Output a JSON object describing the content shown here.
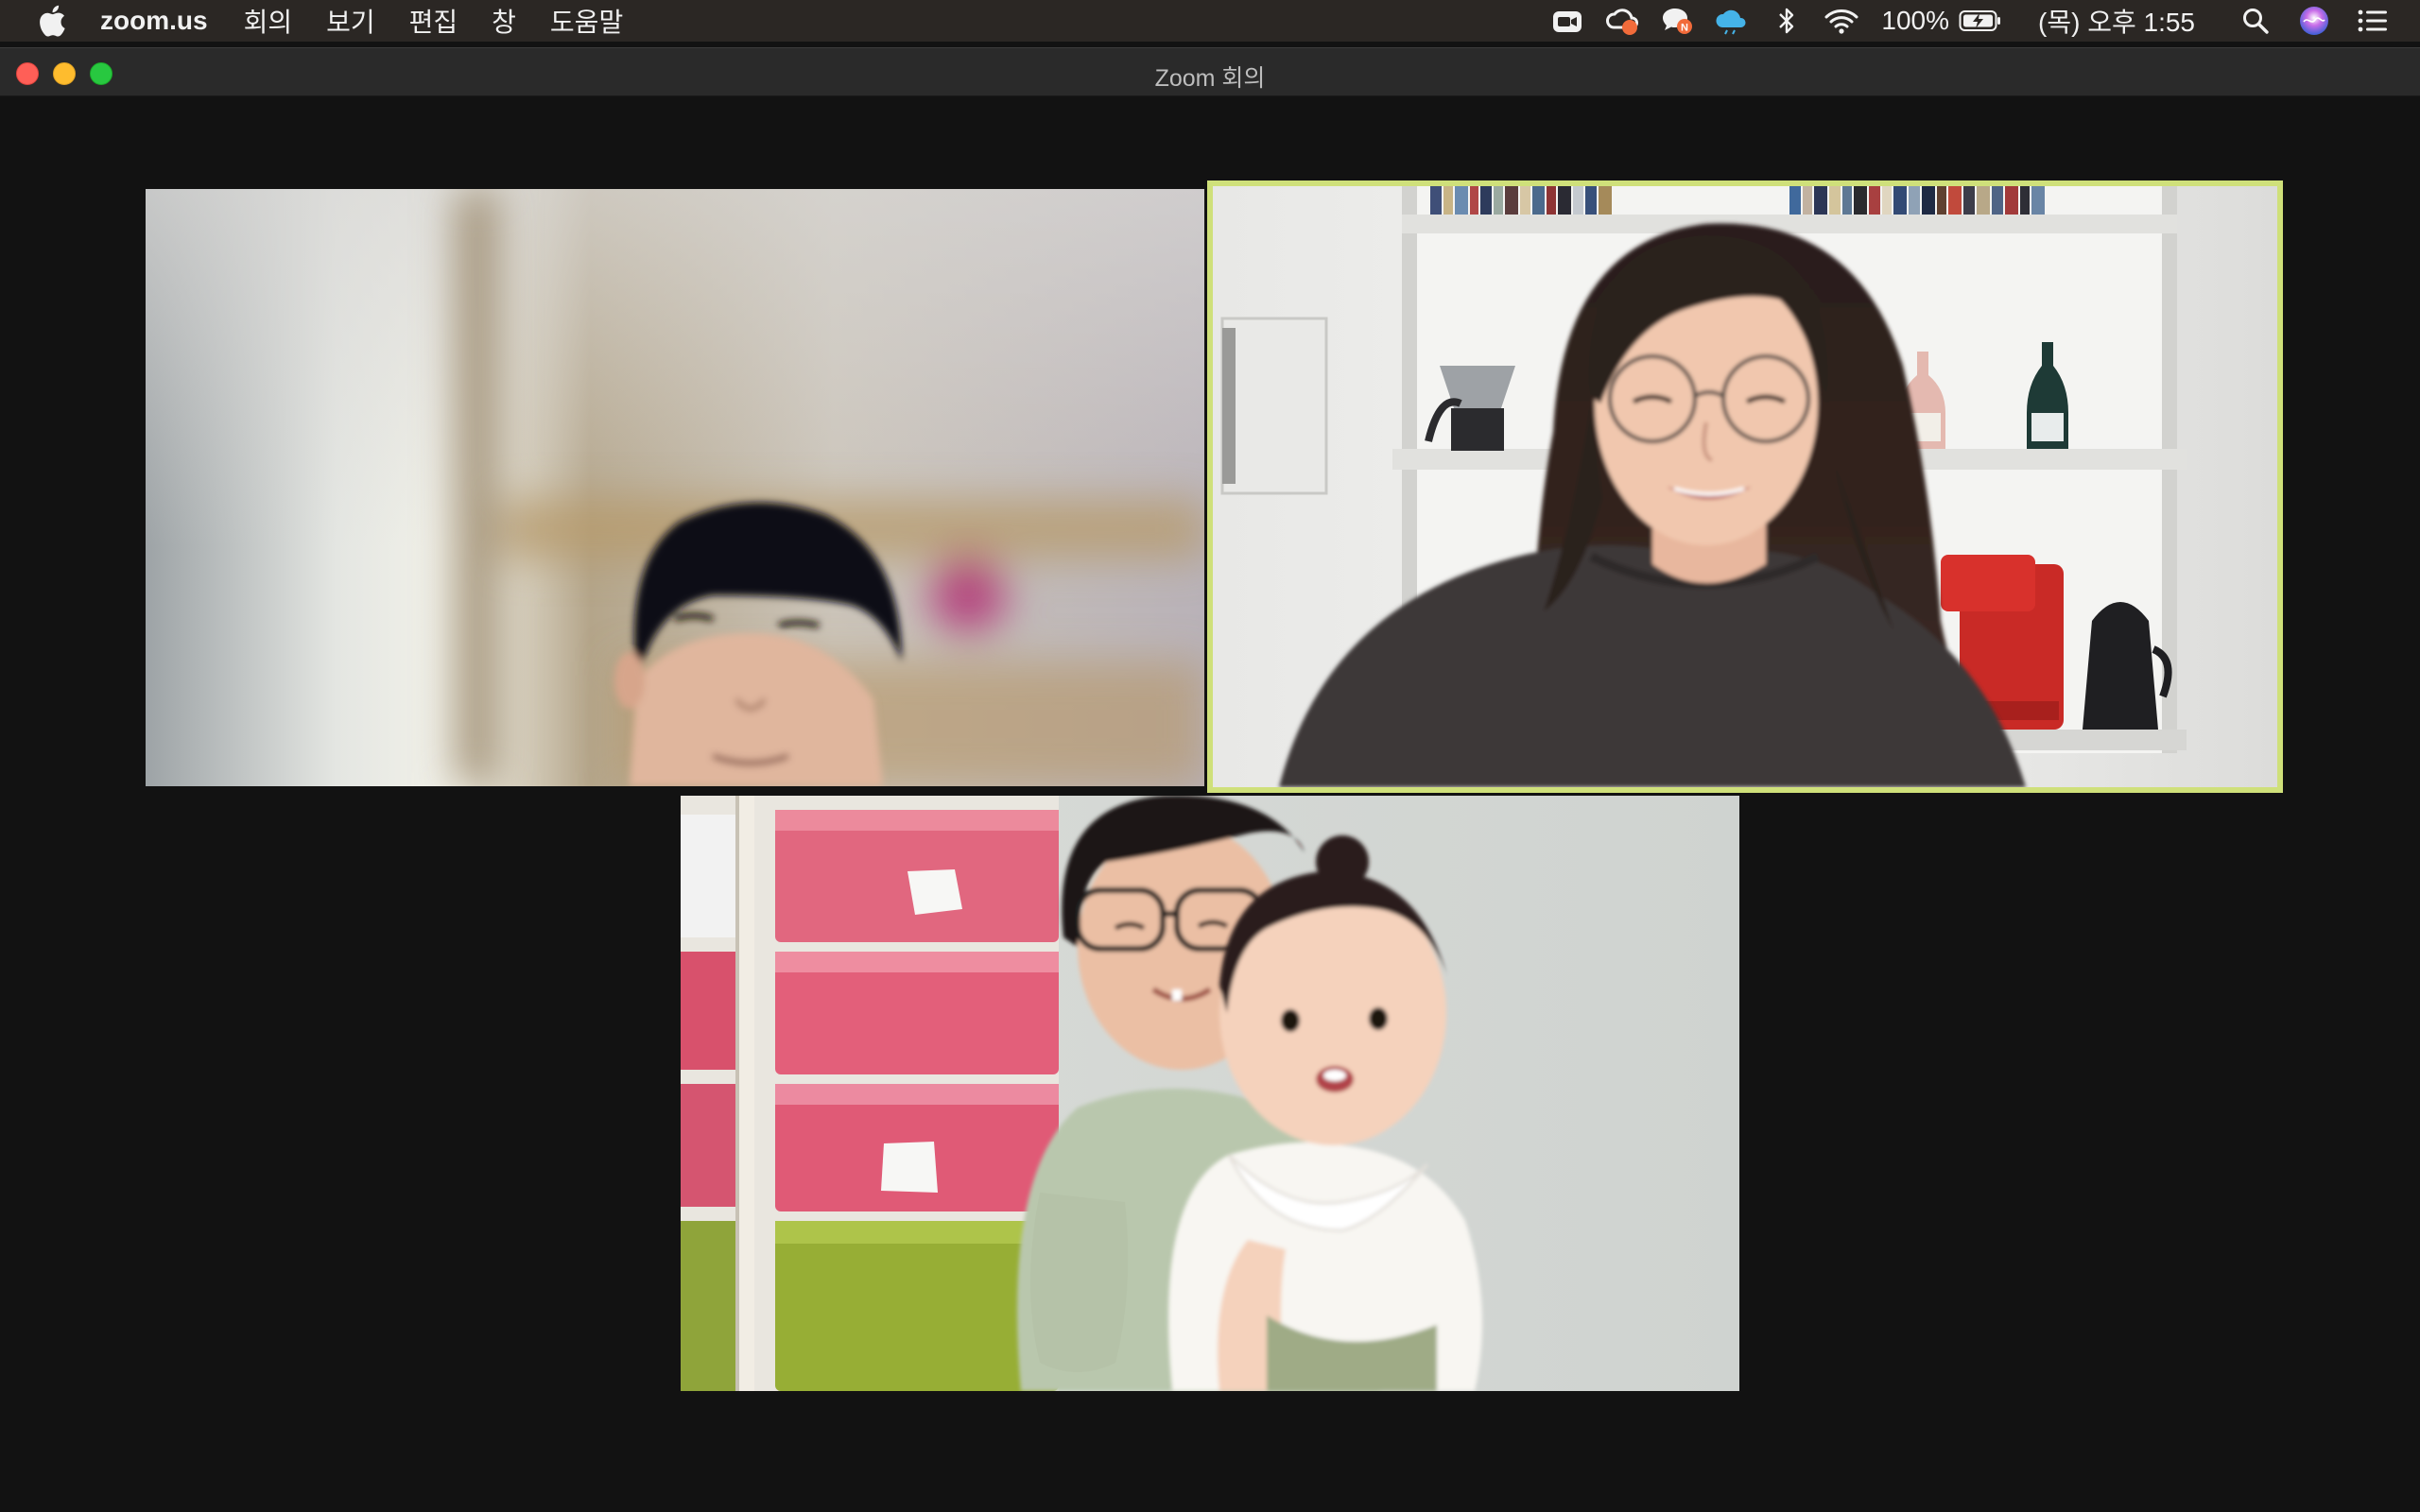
{
  "menubar": {
    "app_name": "zoom.us",
    "items": [
      "회의",
      "보기",
      "편집",
      "창",
      "도움말"
    ],
    "battery": "100%",
    "clock": "(목) 오후 1:55",
    "tray_icons": [
      "zoom-camera-icon",
      "creative-cloud-icon",
      "chat-n-icon",
      "cloud-icon",
      "bluetooth-icon",
      "wifi-icon",
      "battery-charging-icon",
      "spotlight-search-icon",
      "siri-icon",
      "notification-center-icon"
    ]
  },
  "window": {
    "title": "Zoom 회의"
  },
  "participants": [
    {
      "id": "participant-1",
      "active_speaker": false
    },
    {
      "id": "participant-2",
      "active_speaker": true
    },
    {
      "id": "participant-3",
      "active_speaker": false
    }
  ],
  "colors": {
    "active_speaker_border": "#cfe07a",
    "menubar_bg": "#2b2724",
    "window_bg": "#121212"
  }
}
